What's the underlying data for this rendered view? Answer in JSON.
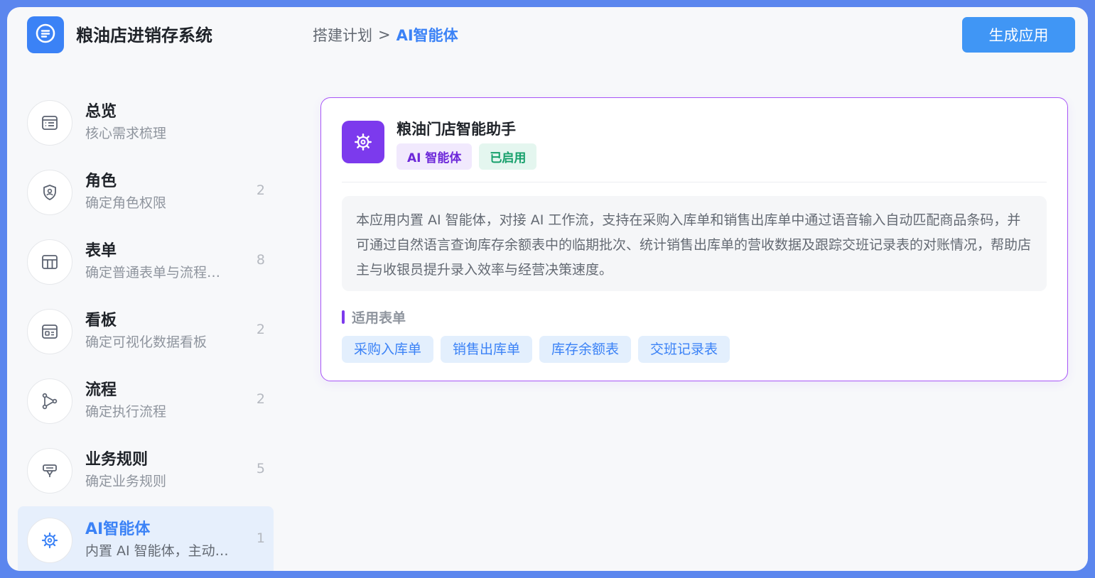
{
  "app": {
    "title": "粮油店进销存系统"
  },
  "breadcrumb": {
    "parent": "搭建计划",
    "separator": ">",
    "current": "AI智能体"
  },
  "header": {
    "generate_label": "生成应用"
  },
  "sidebar": {
    "items": [
      {
        "title": "总览",
        "subtitle": "核心需求梳理",
        "count": "",
        "icon": "overview-icon"
      },
      {
        "title": "角色",
        "subtitle": "确定角色权限",
        "count": "2",
        "icon": "shield-user-icon"
      },
      {
        "title": "表单",
        "subtitle": "确定普通表单与流程…",
        "count": "8",
        "icon": "table-icon"
      },
      {
        "title": "看板",
        "subtitle": "确定可视化数据看板",
        "count": "2",
        "icon": "dashboard-icon"
      },
      {
        "title": "流程",
        "subtitle": "确定执行流程",
        "count": "2",
        "icon": "flow-icon"
      },
      {
        "title": "业务规则",
        "subtitle": "确定业务规则",
        "count": "5",
        "icon": "rule-icon"
      },
      {
        "title": "AI智能体",
        "subtitle": "内置 AI 智能体，主动…",
        "count": "1",
        "icon": "ai-gear-icon"
      }
    ]
  },
  "agent": {
    "name": "粮油门店智能助手",
    "badge_type": "AI 智能体",
    "badge_status": "已启用",
    "description": "本应用内置 AI 智能体，对接 AI 工作流，支持在采购入库单和销售出库单中通过语音输入自动匹配商品条码，并可通过自然语言查询库存余额表中的临期批次、统计销售出库单的营收数据及跟踪交班记录表的对账情况，帮助店主与收银员提升录入效率与经营决策速度。",
    "forms_label": "适用表单",
    "forms": [
      "采购入库单",
      "销售出库单",
      "库存余额表",
      "交班记录表"
    ]
  },
  "colors": {
    "accent": "#3b82f6",
    "purple": "#7c3aed",
    "frame": "#5b86ee"
  }
}
